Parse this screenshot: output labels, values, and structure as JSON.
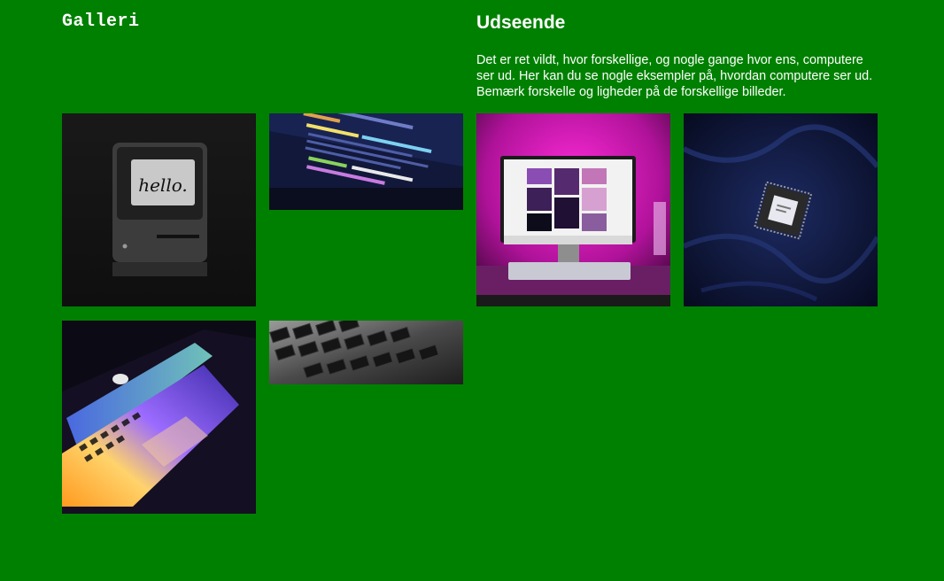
{
  "gallery": {
    "title": "Galleri"
  },
  "appearance": {
    "title": "Udseende",
    "text": "Det er ret vildt, hvor forskellige, og nogle gange hvor ens, computere ser ud. Her kan du se nogle eksempler på, hvordan computere ser ud. Bemærk forskelle og ligheder på de forskellige billeder."
  },
  "photos": [
    {
      "subject": "classic-macintosh",
      "screen_text": "hello."
    },
    {
      "subject": "code-on-laptop-screen",
      "code_lines": [
        "@link",
        "@package",
        "function _minimal_...",
        "/**"
      ]
    },
    {
      "subject": "imac-pink-light"
    },
    {
      "subject": "cpu-chip-on-fabric"
    },
    {
      "subject": "macbook-rainbow-keyboard"
    },
    {
      "subject": "keyboard-closeup"
    }
  ],
  "colors": {
    "background": "#008000",
    "text": "#ffffff"
  }
}
